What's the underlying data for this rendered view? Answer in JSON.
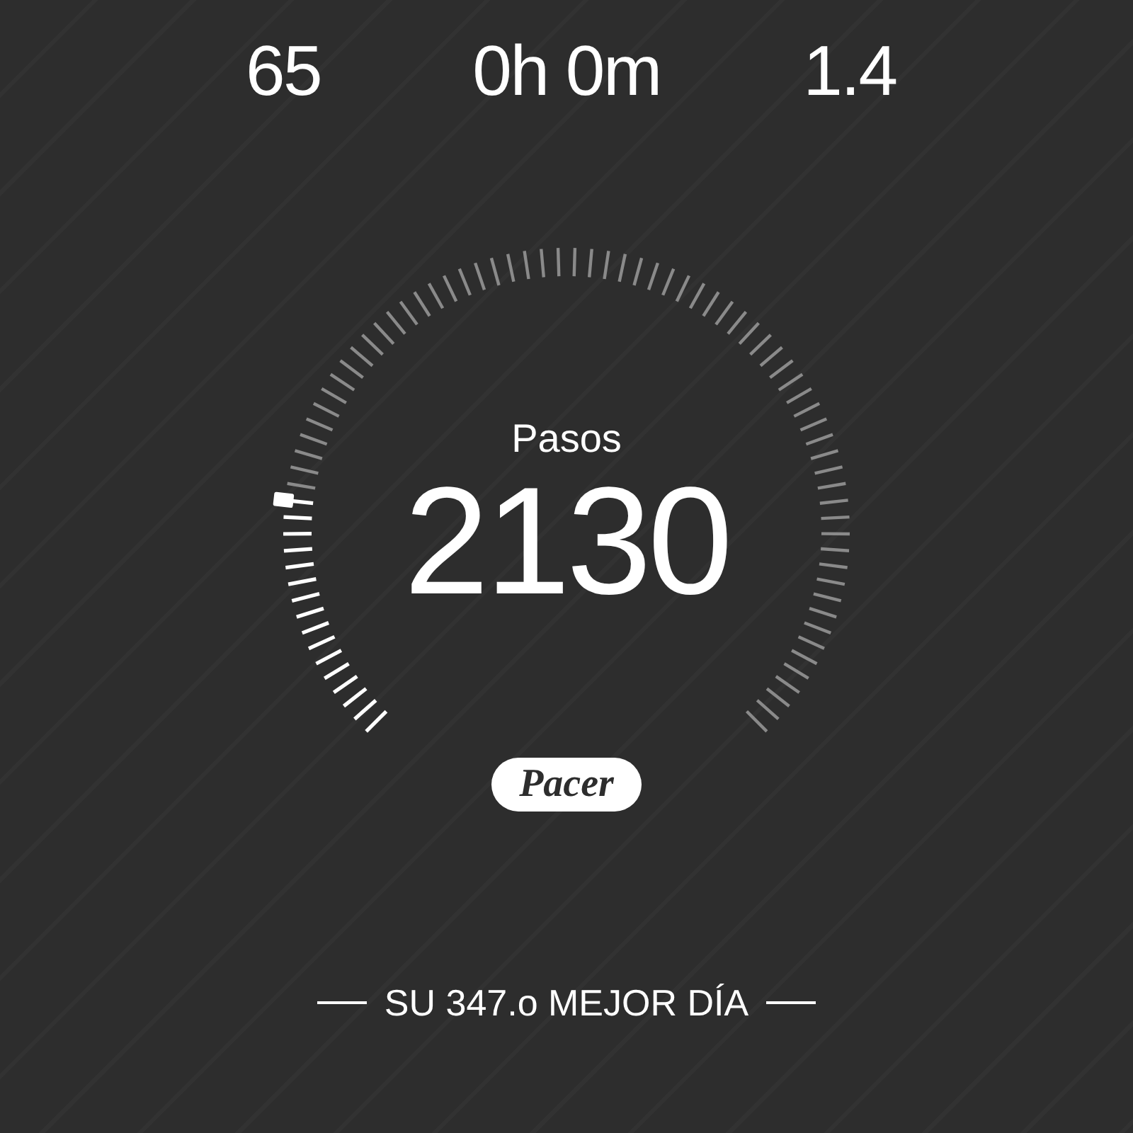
{
  "stats": [
    {
      "value": "65"
    },
    {
      "value": "0h 0m"
    },
    {
      "value": "1.4"
    }
  ],
  "gauge": {
    "label": "Pasos",
    "value": "2130"
  },
  "badge": "Pacer",
  "footer": "SU 347.o MEJOR DÍA"
}
